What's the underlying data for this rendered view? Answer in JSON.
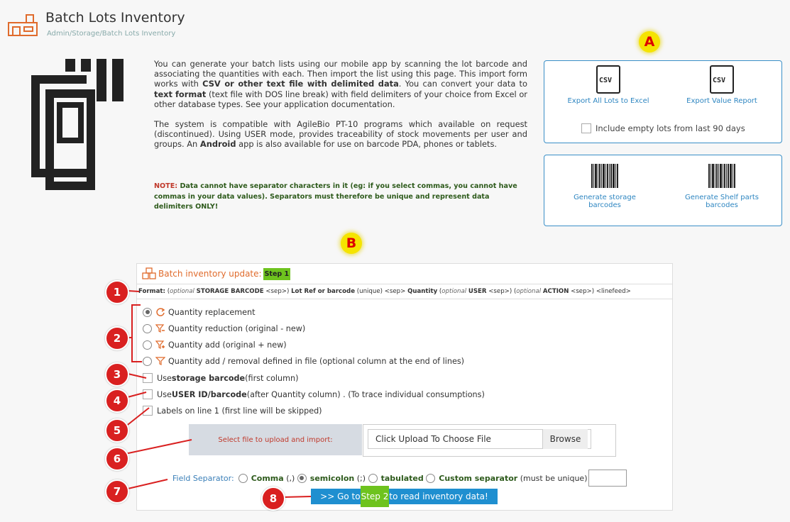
{
  "header": {
    "title": "Batch Lots Inventory",
    "breadcrumb": "Admin/Storage/Batch Lots Inventory"
  },
  "intro": {
    "p1_a": "You can generate your batch lists using our mobile app by scanning the lot barcode and associating the quantities with each. Then import the list using this page. This import form works with ",
    "p1_b": "CSV or other text file with delimited data",
    "p1_c": ". You can convert your data to ",
    "p1_d": "text format",
    "p1_e": " (text file with DOS line break) with field delimiters of your choice from Excel or other database types. See your application documentation.",
    "p2_a": "The system is compatible with AgileBio PT-10 programs which available on request (discontinued). Using USER mode, provides traceability of stock movements per user and groups. An ",
    "p2_b": "Android",
    "p2_c": " app is also available for use on barcode PDA, phones or tablets.",
    "note_label": "NOTE:",
    "note_text": " Data cannot have separator characters in it (eg: if you select commas, you cannot have commas in your data values). Separators must therefore be unique and represent data delimiters ONLY!"
  },
  "markers": {
    "a": "A",
    "b": "B"
  },
  "export": {
    "csv_glyph": "CSV",
    "all_lots": "Export All Lots to Excel",
    "value_report": "Export Value Report",
    "empty_lots": "Include empty lots from last 90 days"
  },
  "barcodes": {
    "storage": "Generate storage barcodes",
    "shelf": "Generate Shelf parts barcodes"
  },
  "panel": {
    "title": "Batch inventory update:",
    "step": "Step 1",
    "format": {
      "label": "Format:",
      "opt1": "optional",
      "sb": "STORAGE BARCODE",
      "sep1": "<sep>",
      "lot": "Lot Ref or barcode",
      "uniq": "(unique)",
      "sep2": "<sep>",
      "qty": "Quantity",
      "opt2": "optional",
      "user": "USER",
      "sep3": "<sep>",
      "opt3": "optional",
      "action": "ACTION",
      "sep4": "<sep>",
      "lf": "<linefeed>"
    },
    "options": [
      "Quantity replacement",
      "Quantity reduction (original - new)",
      "Quantity add (original + new)",
      "Quantity add / removal defined in file (optional column at the end of lines)"
    ],
    "storage_cb_a": "Use ",
    "storage_cb_b": "storage barcode",
    "storage_cb_c": " (first column)",
    "user_cb_a": "Use ",
    "user_cb_b": "USER ID/barcode",
    "user_cb_c": " (after Quantity column) . (To trace individual consumptions)",
    "labels_cb": "Labels on line 1 (first line will be skipped)",
    "upload_label": "Select file to upload and import:",
    "upload_placeholder": "Click Upload To Choose File",
    "browse": "Browse",
    "sep_label": "Field Separator:",
    "sep_comma": "Comma",
    "sep_comma_sym": "(,)",
    "sep_semi": "semicolon",
    "sep_semi_sym": "(;)",
    "sep_tab": "tabulated",
    "sep_custom": "Custom separator",
    "sep_custom_note": "(must be unique)",
    "go_a": ">> Go to ",
    "go_step": "Step 2",
    "go_b": " to read inventory data!"
  },
  "numbers": [
    "1",
    "2",
    "3",
    "4",
    "5",
    "6",
    "7",
    "8"
  ]
}
